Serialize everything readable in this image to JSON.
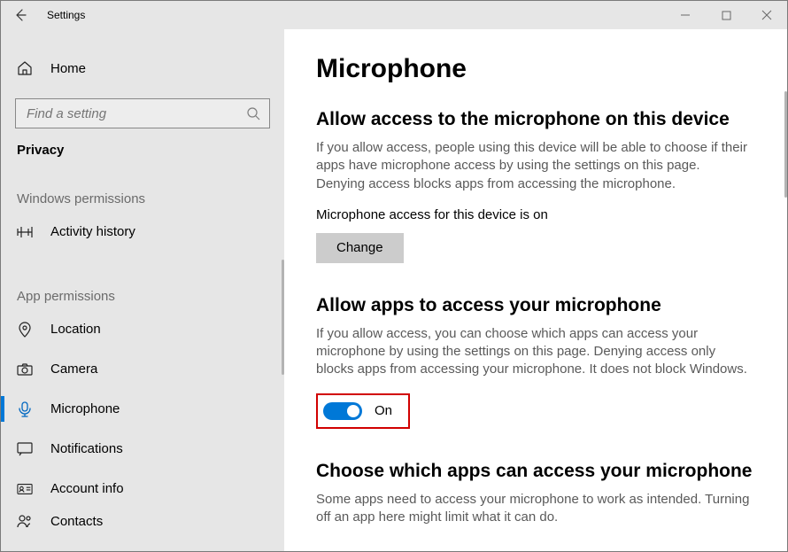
{
  "titlebar": {
    "title": "Settings"
  },
  "sidebar": {
    "home_label": "Home",
    "search_placeholder": "Find a setting",
    "category": "Privacy",
    "groups": [
      {
        "label": "Windows permissions",
        "items": [
          {
            "name": "activity-history",
            "label": "Activity history"
          }
        ]
      },
      {
        "label": "App permissions",
        "items": [
          {
            "name": "location",
            "label": "Location"
          },
          {
            "name": "camera",
            "label": "Camera"
          },
          {
            "name": "microphone",
            "label": "Microphone",
            "active": true
          },
          {
            "name": "notifications",
            "label": "Notifications"
          },
          {
            "name": "account-info",
            "label": "Account info"
          },
          {
            "name": "contacts",
            "label": "Contacts"
          }
        ]
      }
    ]
  },
  "main": {
    "page_title": "Microphone",
    "sections": {
      "device": {
        "heading": "Allow access to the microphone on this device",
        "desc": "If you allow access, people using this device will be able to choose if their apps have microphone access by using the settings on this page. Denying access blocks apps from accessing the microphone.",
        "status_line": "Microphone access for this device is on",
        "button_label": "Change"
      },
      "apps": {
        "heading": "Allow apps to access your microphone",
        "desc": "If you allow access, you can choose which apps can access your microphone by using the settings on this page. Denying access only blocks apps from accessing your microphone. It does not block Windows.",
        "toggle_state": "On"
      },
      "choose": {
        "heading": "Choose which apps can access your microphone",
        "desc": "Some apps need to access your microphone to work as intended. Turning off an app here might limit what it can do."
      }
    }
  }
}
